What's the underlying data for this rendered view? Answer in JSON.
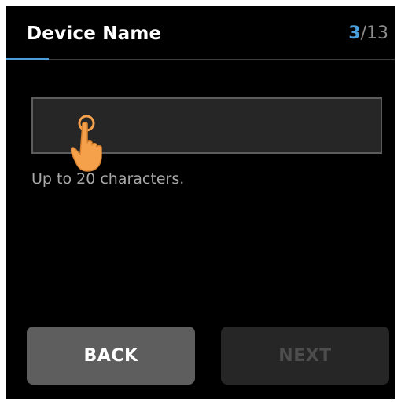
{
  "header": {
    "title": "Device Name",
    "step_current": "3",
    "step_total": "/13"
  },
  "device_name_field": {
    "value": "",
    "hint": "Up to 20 characters."
  },
  "buttons": {
    "back_label": "BACK",
    "next_label": "NEXT"
  },
  "icons": {
    "tap_hint": "hand-pointer-icon"
  },
  "colors": {
    "accent": "#4a9edb",
    "background": "#000000",
    "back_button": "#5e5e5e",
    "next_button_disabled": "#262626",
    "tap_hand": "#f5a04a"
  }
}
